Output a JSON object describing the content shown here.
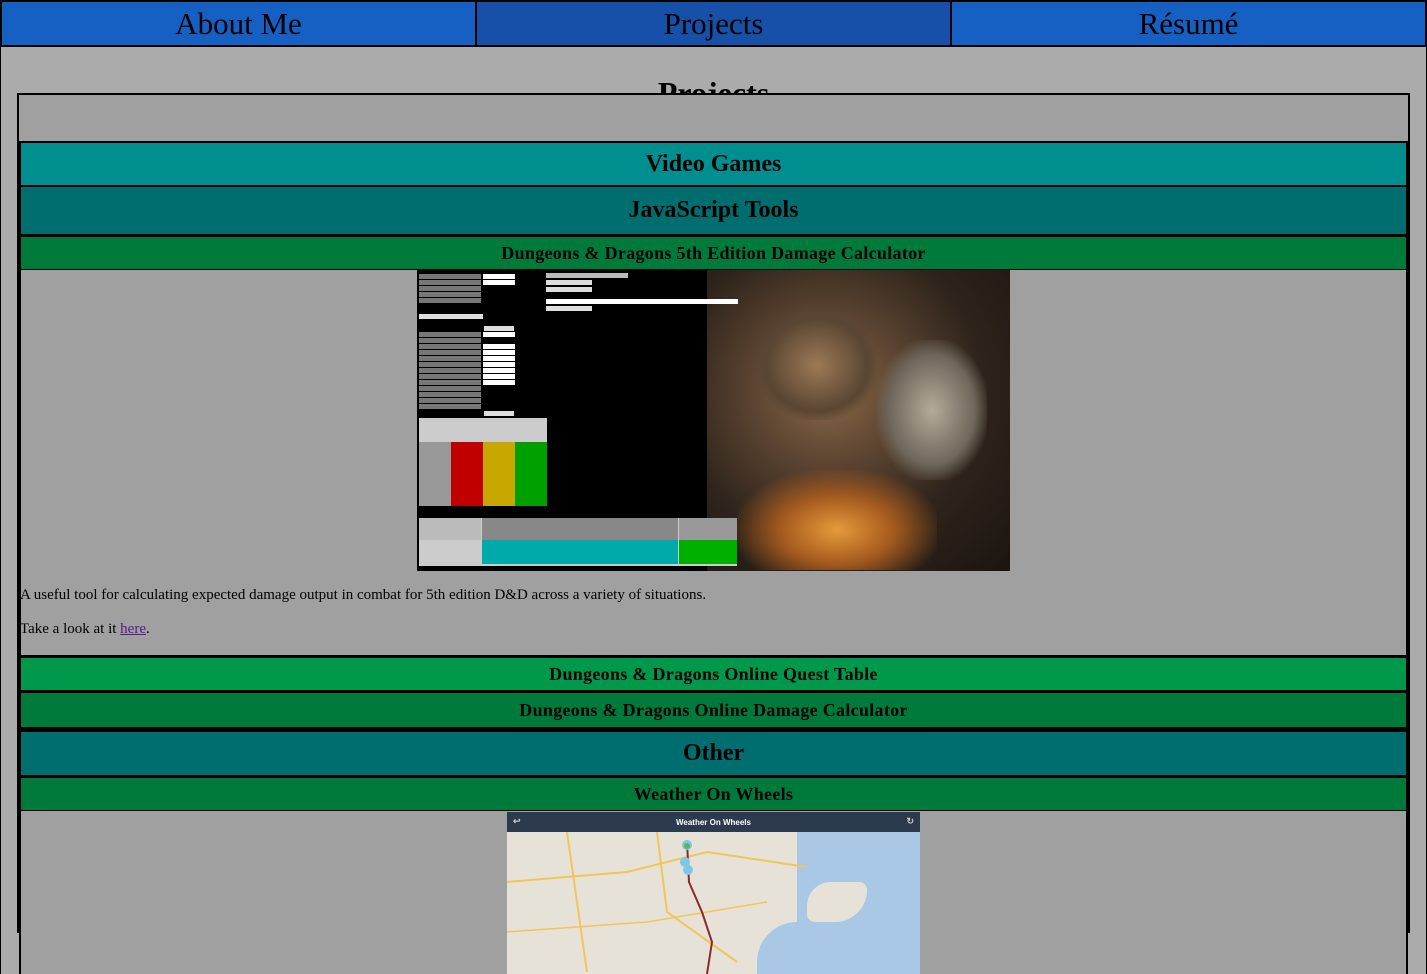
{
  "nav": {
    "items": [
      {
        "label": "About Me"
      },
      {
        "label": "Projects"
      },
      {
        "label": "Résumé"
      }
    ],
    "active": "Projects"
  },
  "page": {
    "title": "Projects"
  },
  "sections": {
    "video_games": {
      "label": "Video Games"
    },
    "javascript_tools": {
      "label": "JavaScript Tools",
      "projects": {
        "dnd5e": {
          "title": "Dungeons & Dragons 5th Edition Damage Calculator",
          "description": "A useful tool for calculating expected damage output in combat for 5th edition D&D across a variety of situations.",
          "link_prefix": "Take a look at it ",
          "link_text": "here",
          "link_suffix": "."
        },
        "ddo_quest": {
          "title": "Dungeons & Dragons Online Quest Table"
        },
        "ddo_damage": {
          "title": "Dungeons & Dragons Online Damage Calculator"
        }
      }
    },
    "other": {
      "label": "Other",
      "projects": {
        "weather": {
          "title": "Weather On Wheels",
          "app_bar_title": "Weather On Wheels"
        }
      }
    }
  },
  "colors": {
    "nav_bg": "#1560c2",
    "nav_active": "#1650a8",
    "page_bg": "#ababab",
    "video_games_bar": "#008e8e",
    "category_bar": "#006e6e",
    "project_bar_dark": "#007a3a",
    "project_bar_light": "#00994c",
    "link": "#551a8b"
  },
  "icons": [
    "dnd-calculator-screenshot",
    "weather-map-screenshot"
  ]
}
